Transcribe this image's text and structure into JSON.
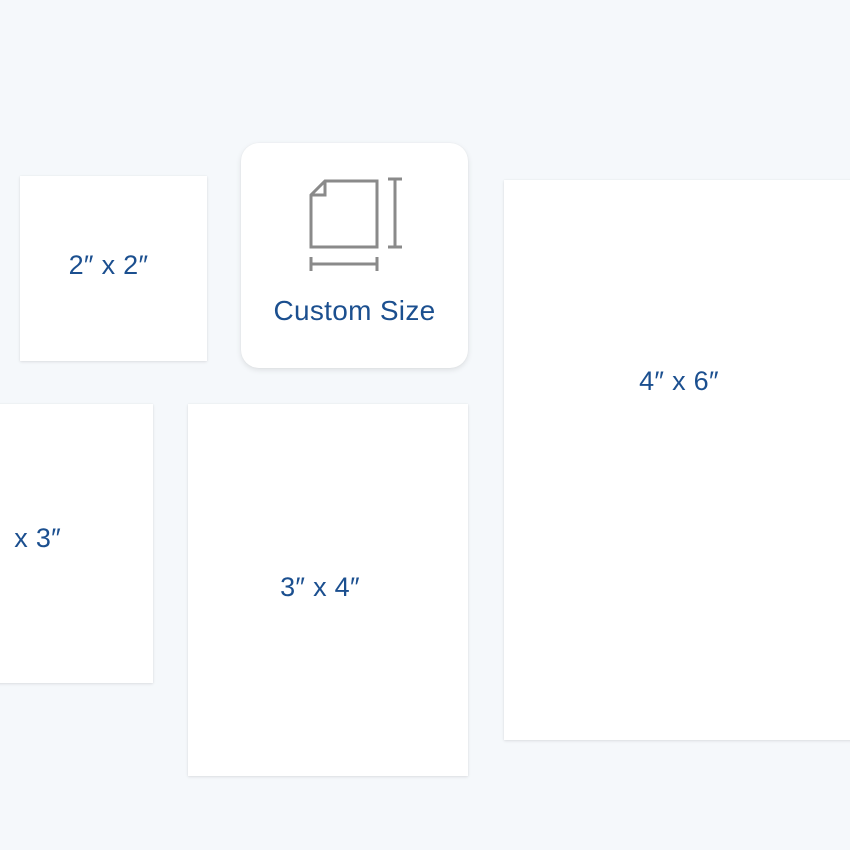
{
  "sizes": {
    "two_by_two": "2″ x 2″",
    "custom": "Custom Size",
    "two_by_three": "x 3″",
    "three_by_four": "3″ x 4″",
    "four_by_six": "4″ x 6″"
  },
  "colors": {
    "background": "#f5f8fb",
    "card": "#ffffff",
    "label": "#1b4f8f",
    "icon": "#8a8a8a"
  },
  "icons": {
    "custom": "custom-size-icon"
  }
}
